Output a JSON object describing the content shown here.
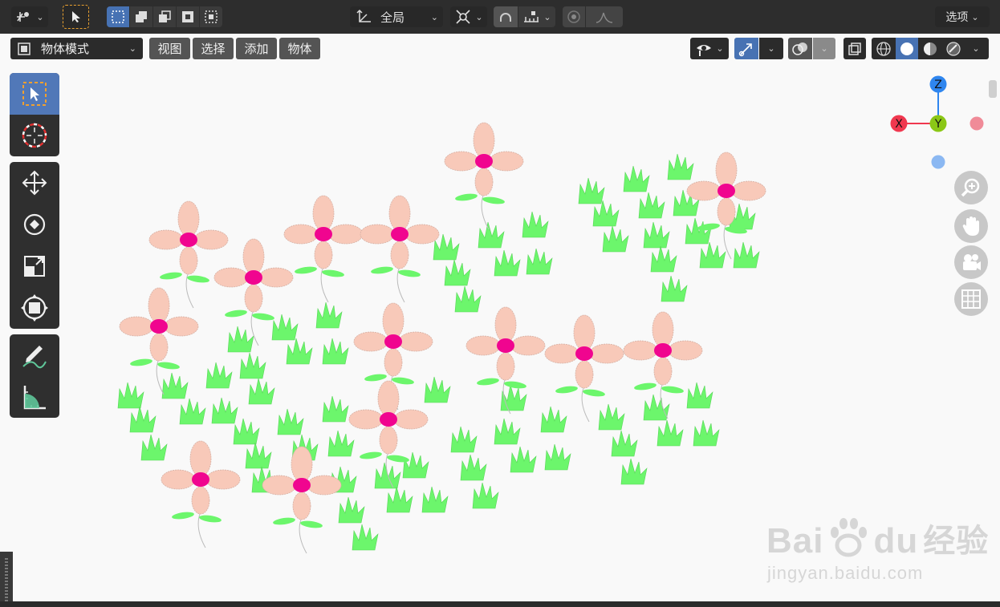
{
  "topbar": {
    "orientation_label": "全局",
    "options_label": "选项"
  },
  "header": {
    "mode_label": "物体模式",
    "menus": [
      "视图",
      "选择",
      "添加",
      "物体"
    ]
  },
  "gizmo": {
    "z_label": "Z",
    "x_label": "X",
    "y_label": "Y"
  },
  "watermark": {
    "logo_text": "Bai",
    "logo_text2": "du",
    "logo_cn": "经验",
    "url": "jingyan.baidu.com"
  },
  "colors": {
    "viewport_bg": "#f9f9f9",
    "accent": "#4772b3",
    "petal": "#f8c9b9",
    "flower_center": "#f0058f",
    "grass": "#6cf66c",
    "axis_x": "#f0384f",
    "axis_y": "#8bc716",
    "axis_z": "#2f86ef"
  }
}
